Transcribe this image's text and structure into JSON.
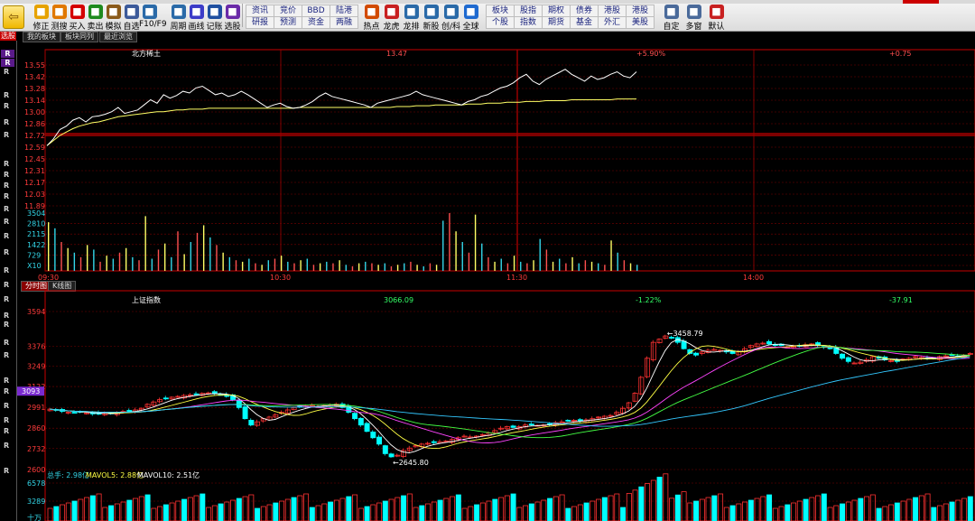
{
  "toolbar": {
    "back_label": "⇦",
    "buttons": [
      {
        "label": "修正",
        "icon": "star-icon",
        "color": "#e6a200"
      },
      {
        "label": "测搜",
        "icon": "clock-icon",
        "color": "#e07800"
      },
      {
        "label": "买入",
        "icon": "buy-icon",
        "color": "#d40000"
      },
      {
        "label": "卖出",
        "icon": "sell-icon",
        "color": "#1e8a1e"
      },
      {
        "label": "模拟",
        "icon": "hammer-icon",
        "color": "#8a5a1a"
      },
      {
        "label": "自选",
        "icon": "monitor-icon",
        "color": "#3c5a9a"
      },
      {
        "label": "F10/F9",
        "icon": "table-icon",
        "color": "#2a6aa8"
      },
      {
        "label": "周期",
        "icon": "cycle-icon",
        "color": "#2a6aa8"
      },
      {
        "label": "画线",
        "icon": "pencil-icon",
        "color": "#3c3cc8"
      },
      {
        "label": "记账",
        "icon": "note-icon",
        "color": "#1f4fa0"
      },
      {
        "label": "选股",
        "icon": "magnify-icon",
        "color": "#6a2aa8"
      }
    ],
    "grid_buttons": [
      [
        "资讯",
        "研报"
      ],
      [
        "竞价",
        "预测"
      ],
      [
        "BBD",
        "资金"
      ],
      [
        "陆港",
        "两融"
      ]
    ],
    "mid_buttons": [
      {
        "label": "热点",
        "icon": "fire-icon",
        "color": "#d24a00"
      },
      {
        "label": "龙虎",
        "icon": "dragon-icon",
        "color": "#c82020"
      },
      {
        "label": "龙排",
        "icon": "rank-icon",
        "color": "#2a6aa8"
      },
      {
        "label": "新股",
        "icon": "newstock-icon",
        "color": "#2a6aa8"
      },
      {
        "label": "创/科",
        "icon": "chart-icon",
        "color": "#2a6aa8"
      },
      {
        "label": "全球",
        "icon": "globe-icon",
        "color": "#1f6ad0"
      }
    ],
    "grid_buttons2": [
      [
        "板块",
        "个股"
      ],
      [
        "股指",
        "指数"
      ],
      [
        "期权",
        "期货"
      ],
      [
        "债券",
        "基金"
      ],
      [
        "港股",
        "外汇"
      ],
      [
        "港股",
        "美股"
      ]
    ],
    "right_buttons": [
      {
        "label": "自定",
        "icon": "custom-icon",
        "color": "#4a6a9a"
      },
      {
        "label": "多窗",
        "icon": "windows-icon",
        "color": "#4a6a9a"
      },
      {
        "label": "默认",
        "icon": "home-icon",
        "color": "#c82020"
      }
    ]
  },
  "side": {
    "label": "选股",
    "r_labels": [
      "R",
      "R",
      "R",
      "R",
      "R",
      "R",
      "R",
      "R",
      "R",
      "R",
      "R",
      "R",
      "R",
      "R",
      "R",
      "R",
      "R",
      "R",
      "R",
      "R",
      "R",
      "R",
      "R",
      "R",
      "R",
      "R",
      "R",
      "R",
      "R"
    ]
  },
  "tabs": {
    "top": [
      "我的板块",
      "板块同列",
      "最近浏览"
    ],
    "bottom": [
      "分时图",
      "K线图"
    ]
  },
  "intraday": {
    "title": "北方稀土",
    "price_label": "13.47",
    "pct_label": "+5.90%",
    "chg_label": "+0.75",
    "yticks": [
      "13.55",
      "13.42",
      "13.28",
      "13.14",
      "13.00",
      "12.86",
      "12.72",
      "12.59",
      "12.45",
      "12.31",
      "12.17",
      "12.03",
      "11.89"
    ],
    "vol_ticks": [
      "3504",
      "2810",
      "2115",
      "1422",
      "729",
      "X10"
    ],
    "xticks": [
      "09:30",
      "10:30",
      "11:30",
      "14:00"
    ],
    "price_series": [
      12.6,
      12.68,
      12.79,
      12.83,
      12.9,
      12.93,
      12.88,
      12.94,
      12.95,
      12.97,
      13.0,
      13.05,
      12.98,
      13.0,
      13.02,
      13.08,
      13.14,
      13.1,
      13.2,
      13.16,
      13.19,
      13.24,
      13.22,
      13.28,
      13.3,
      13.25,
      13.2,
      13.22,
      13.18,
      13.2,
      13.24,
      13.2,
      13.15,
      13.1,
      13.05,
      13.08,
      13.1,
      13.06,
      13.04,
      13.05,
      13.08,
      13.12,
      13.18,
      13.22,
      13.18,
      13.16,
      13.14,
      13.12,
      13.1,
      13.08,
      13.05,
      13.1,
      13.12,
      13.14,
      13.16,
      13.18,
      13.2,
      13.24,
      13.2,
      13.18,
      13.16,
      13.14,
      13.12,
      13.1,
      13.08,
      13.12,
      13.14,
      13.18,
      13.2,
      13.24,
      13.28,
      13.3,
      13.34,
      13.4,
      13.44,
      13.36,
      13.32,
      13.38,
      13.42,
      13.46,
      13.5,
      13.44,
      13.4,
      13.36,
      13.42,
      13.38,
      13.4,
      13.44,
      13.47,
      13.42,
      13.4,
      13.47
    ],
    "avg_series": [
      12.6,
      12.66,
      12.72,
      12.76,
      12.8,
      12.83,
      12.85,
      12.87,
      12.88,
      12.9,
      12.92,
      12.94,
      12.95,
      12.96,
      12.97,
      12.98,
      12.99,
      13.0,
      13.0,
      13.01,
      13.02,
      13.02,
      13.03,
      13.03,
      13.03,
      13.04,
      13.04,
      13.04,
      13.04,
      13.04,
      13.04,
      13.04,
      13.04,
      13.04,
      13.04,
      13.04,
      13.04,
      13.04,
      13.04,
      13.05,
      13.05,
      13.05,
      13.05,
      13.05,
      13.05,
      13.05,
      13.05,
      13.05,
      13.05,
      13.05,
      13.05,
      13.05,
      13.05,
      13.05,
      13.06,
      13.06,
      13.06,
      13.07,
      13.07,
      13.07,
      13.08,
      13.08,
      13.08,
      13.08,
      13.08,
      13.09,
      13.09,
      13.09,
      13.1,
      13.1,
      13.1,
      13.11,
      13.11,
      13.11,
      13.12,
      13.12,
      13.12,
      13.13,
      13.13,
      13.13,
      13.13,
      13.14,
      13.14,
      13.14,
      13.14,
      13.14,
      13.14,
      13.14,
      13.15,
      13.15,
      13.15,
      13.15
    ],
    "volumes": [
      3200,
      2800,
      1900,
      1500,
      1200,
      900,
      1700,
      1400,
      600,
      1000,
      800,
      1200,
      1500,
      900,
      700,
      3600,
      800,
      1400,
      1800,
      900,
      2600,
      1100,
      1900,
      2500,
      3000,
      2200,
      1700,
      1200,
      900,
      700,
      600,
      800,
      500,
      400,
      700,
      800,
      1000,
      600,
      500,
      700,
      800,
      400,
      500,
      600,
      500,
      700,
      400,
      300,
      500,
      600,
      500,
      400,
      500,
      300,
      400,
      500,
      600,
      400,
      300,
      500,
      400,
      3300,
      3800,
      2600,
      1900,
      1200,
      3700,
      1800,
      900,
      600,
      800,
      500,
      1000,
      600,
      500,
      700,
      2100,
      1400,
      600,
      800,
      500,
      900,
      500,
      700,
      600,
      500,
      400,
      2000,
      1200,
      700,
      500,
      400
    ]
  },
  "kline": {
    "title": "上证指数",
    "price_label": "3066.09",
    "pct_label": "-1.22%",
    "chg_label": "-37.91",
    "yticks": [
      "3594",
      "3376",
      "3249",
      "3122",
      "2991",
      "2860",
      "2732",
      "2600"
    ],
    "current_marker": "3093",
    "high_annotation": "3458.79",
    "low_annotation": "2645.80",
    "vol_legend": {
      "total": "总手: 2.98亿",
      "mavol5": "MAVOL5: 2.88亿",
      "mavol10": "MAVOL10: 2.51亿"
    },
    "vol_ticks": [
      "6578",
      "3289",
      "十万"
    ],
    "closes": [
      2980,
      2972,
      2966,
      2960,
      2958,
      2962,
      2956,
      2950,
      2948,
      2952,
      2955,
      2960,
      2966,
      2970,
      2975,
      2985,
      3010,
      3025,
      3040,
      3048,
      3055,
      3060,
      3066,
      3070,
      3075,
      3080,
      3082,
      3078,
      3070,
      3060,
      3040,
      2990,
      2920,
      2880,
      2900,
      2920,
      2930,
      2945,
      2960,
      2975,
      2990,
      2995,
      3000,
      3005,
      2995,
      3002,
      3008,
      3012,
      2990,
      2960,
      2920,
      2880,
      2840,
      2800,
      2760,
      2700,
      2680,
      2690,
      2720,
      2735,
      2750,
      2760,
      2765,
      2770,
      2775,
      2780,
      2790,
      2800,
      2810,
      2805,
      2810,
      2820,
      2830,
      2845,
      2860,
      2870,
      2865,
      2870,
      2880,
      2885,
      2878,
      2880,
      2885,
      2895,
      2900,
      2908,
      2910,
      2905,
      2912,
      2920,
      2930,
      2935,
      2940,
      2960,
      2985,
      3020,
      3080,
      3180,
      3300,
      3400,
      3420,
      3440,
      3430,
      3400,
      3360,
      3330,
      3320,
      3340,
      3350,
      3355,
      3350,
      3340,
      3330,
      3340,
      3360,
      3380,
      3390,
      3395,
      3390,
      3385,
      3380,
      3370,
      3375,
      3380,
      3385,
      3390,
      3380,
      3370,
      3360,
      3330,
      3300,
      3280,
      3270,
      3275,
      3290,
      3310,
      3300,
      3290,
      3285,
      3280,
      3295,
      3300,
      3310,
      3305,
      3295,
      3300,
      3310,
      3315,
      3320,
      3310,
      3320,
      3330
    ]
  },
  "colors": {
    "up": "#ff3232",
    "down": "#00ffff",
    "grid": "#7a0000",
    "axis": "#c80000",
    "price": "#ffffff",
    "avg": "#ffff66"
  }
}
